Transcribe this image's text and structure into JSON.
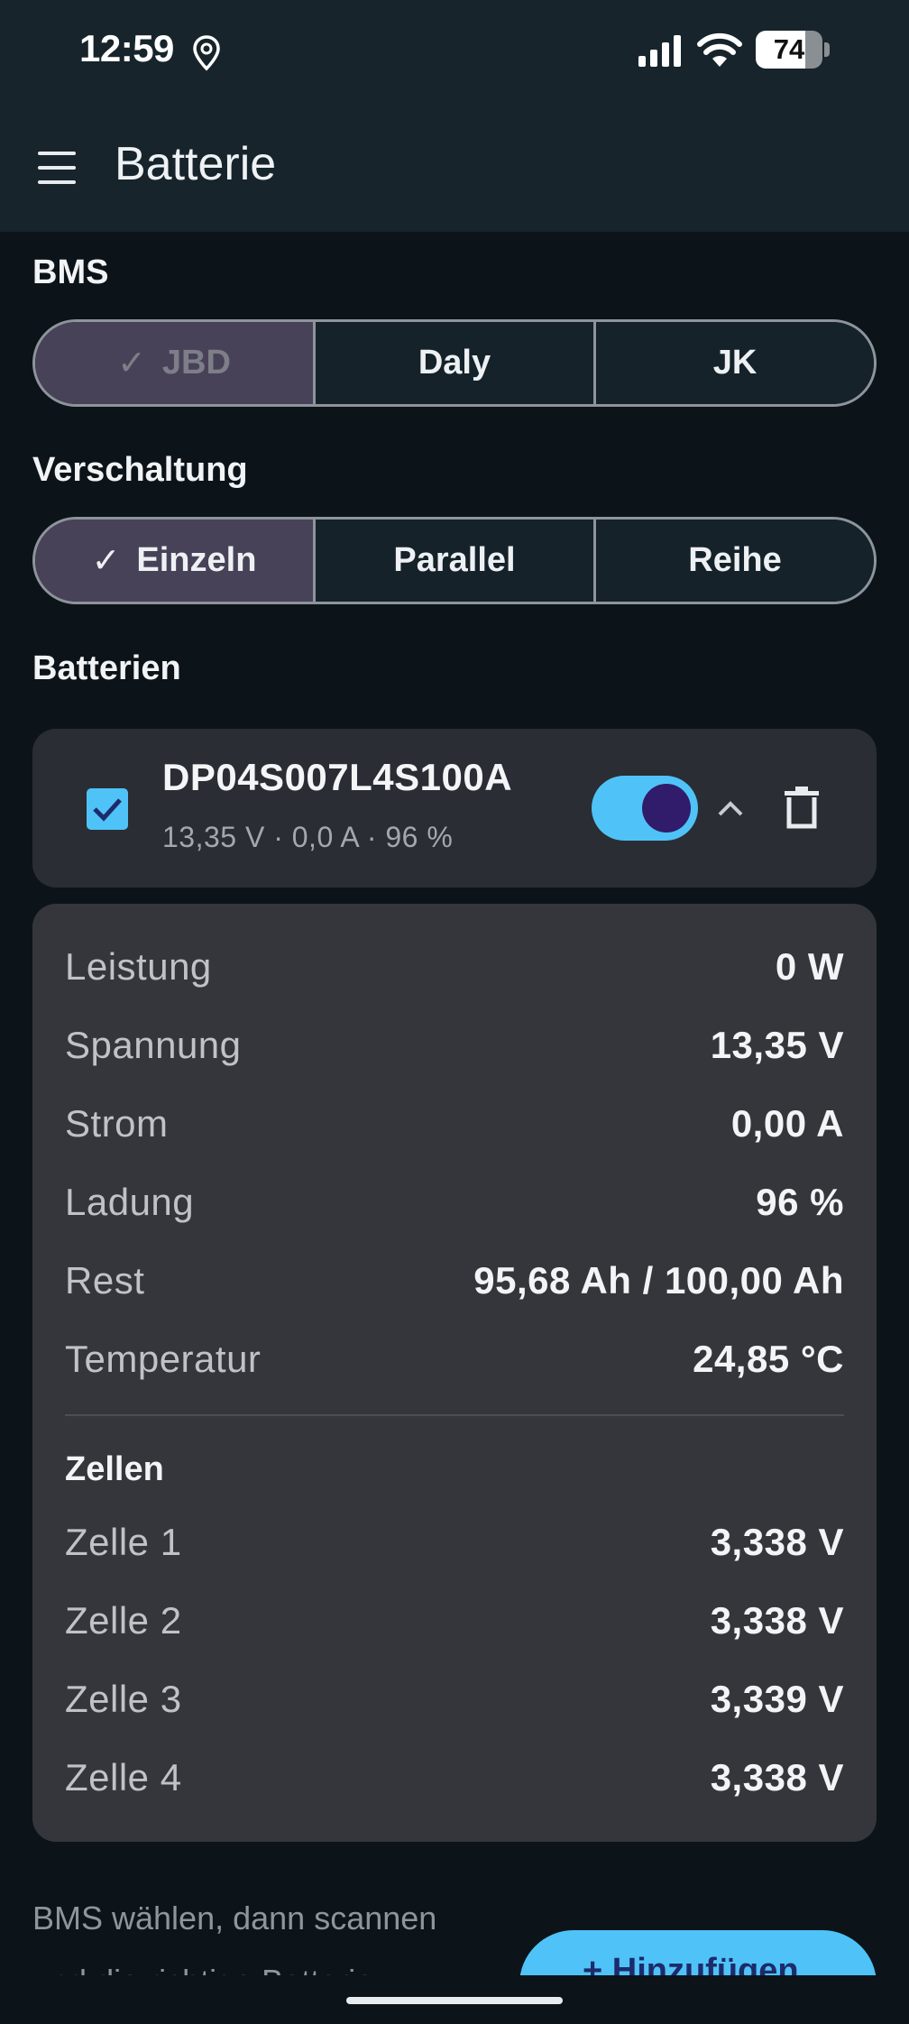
{
  "status_bar": {
    "time": "12:59",
    "battery_level": "74",
    "battery_fraction": 0.74
  },
  "app_bar": {
    "title": "Batterie"
  },
  "bms": {
    "label": "BMS",
    "options": [
      {
        "label": "JBD",
        "selected": true,
        "disabled": true
      },
      {
        "label": "Daly",
        "selected": false
      },
      {
        "label": "JK",
        "selected": false
      }
    ]
  },
  "verschaltung": {
    "label": "Verschaltung",
    "options": [
      {
        "label": "Einzeln",
        "selected": true
      },
      {
        "label": "Parallel",
        "selected": false
      },
      {
        "label": "Reihe",
        "selected": false
      }
    ]
  },
  "batteries": {
    "label": "Batterien",
    "items": [
      {
        "name": "DP04S007L4S100A",
        "summary": "13,35 V · 0,0 A · 96 %",
        "checked": true,
        "enabled": true,
        "expanded": true
      }
    ]
  },
  "details": {
    "rows": [
      {
        "label": "Leistung",
        "value": "0 W"
      },
      {
        "label": "Spannung",
        "value": "13,35 V"
      },
      {
        "label": "Strom",
        "value": "0,00 A"
      },
      {
        "label": "Ladung",
        "value": "96 %"
      },
      {
        "label": "Rest",
        "value": "95,68 Ah / 100,00 Ah"
      },
      {
        "label": "Temperatur",
        "value": "24,85 °C"
      }
    ],
    "cells_title": "Zellen",
    "cells": [
      {
        "label": "Zelle 1",
        "value": "3,338 V"
      },
      {
        "label": "Zelle 2",
        "value": "3,338 V"
      },
      {
        "label": "Zelle 3",
        "value": "3,339 V"
      },
      {
        "label": "Zelle 4",
        "value": "3,338 V"
      }
    ]
  },
  "footer": {
    "hint_line1": "BMS wählen, dann scannen",
    "hint_line2": "und die richtige Batterie",
    "add_button": "+ Hinzufügen"
  },
  "colors": {
    "accent": "#4fc3f7",
    "selected_segment": "#484258",
    "background": "#0d1419",
    "card": "#35363c"
  }
}
